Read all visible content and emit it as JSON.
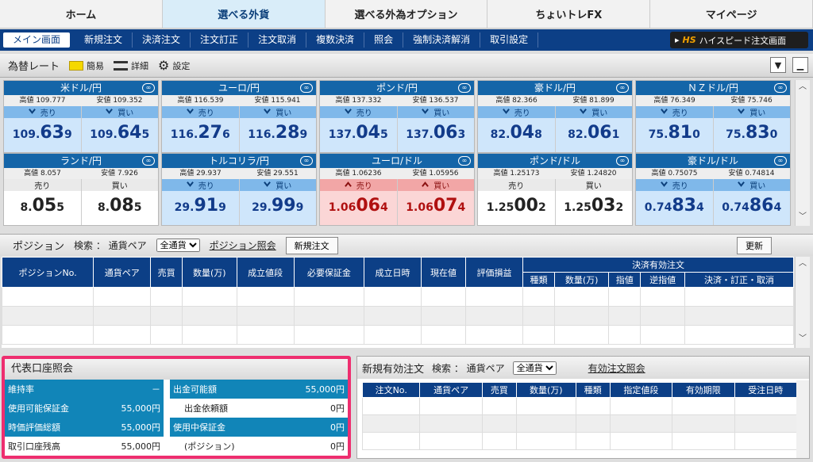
{
  "topnav": [
    "ホーム",
    "選べる外貨",
    "選べる外為オプション",
    "ちょいトレFX",
    "マイページ"
  ],
  "subnav": [
    "メイン画面",
    "新規注文",
    "決済注文",
    "注文訂正",
    "注文取消",
    "複数決済",
    "照会",
    "強制決済解消",
    "取引設定"
  ],
  "highspeed": {
    "hs": "HS",
    "label": "ハイスピード注文画面"
  },
  "ratebar": {
    "title": "為替レート",
    "simple": "簡易",
    "detail": "詳細",
    "settings": "設定"
  },
  "rates": [
    {
      "pair": "米ドル/円",
      "high": "高値 109.777",
      "low": "安値 109.352",
      "sell_label": "売り",
      "buy_label": "買い",
      "sell": [
        "109.",
        "63",
        "9"
      ],
      "buy": [
        "109.",
        "64",
        "5"
      ],
      "style": "blue"
    },
    {
      "pair": "ユーロ/円",
      "high": "高値 116.539",
      "low": "安値 115.941",
      "sell_label": "売り",
      "buy_label": "買い",
      "sell": [
        "116.",
        "27",
        "6"
      ],
      "buy": [
        "116.",
        "28",
        "9"
      ],
      "style": "blue"
    },
    {
      "pair": "ポンド/円",
      "high": "高値 137.332",
      "low": "安値 136.537",
      "sell_label": "売り",
      "buy_label": "買い",
      "sell": [
        "137.",
        "04",
        "5"
      ],
      "buy": [
        "137.",
        "06",
        "3"
      ],
      "style": "blue"
    },
    {
      "pair": "豪ドル/円",
      "high": "高値 82.366",
      "low": "安値 81.899",
      "sell_label": "売り",
      "buy_label": "買い",
      "sell": [
        "82.",
        "04",
        "8"
      ],
      "buy": [
        "82.",
        "06",
        "1"
      ],
      "style": "blue"
    },
    {
      "pair": "ＮＺドル/円",
      "high": "高値 76.349",
      "low": "安値 75.746",
      "sell_label": "売り",
      "buy_label": "買い",
      "sell": [
        "75.",
        "81",
        "0"
      ],
      "buy": [
        "75.",
        "83",
        "0"
      ],
      "style": "blue"
    },
    {
      "pair": "ランド/円",
      "high": "高値 8.057",
      "low": "安値 7.926",
      "sell_label": "売り",
      "buy_label": "買い",
      "sell": [
        "8.",
        "05",
        "5"
      ],
      "buy": [
        "8.",
        "08",
        "5"
      ],
      "style": "grey"
    },
    {
      "pair": "トルコリラ/円",
      "high": "高値 29.937",
      "low": "安値 29.551",
      "sell_label": "売り",
      "buy_label": "買い",
      "sell": [
        "29.",
        "91",
        "9"
      ],
      "buy": [
        "29.",
        "99",
        "9"
      ],
      "style": "blue"
    },
    {
      "pair": "ユーロ/ドル",
      "high": "高値 1.06236",
      "low": "安値 1.05956",
      "sell_label": "売り",
      "buy_label": "買い",
      "sell": [
        "1.06",
        "06",
        "4"
      ],
      "buy": [
        "1.06",
        "07",
        "4"
      ],
      "style": "red"
    },
    {
      "pair": "ポンド/ドル",
      "high": "高値 1.25173",
      "low": "安値 1.24820",
      "sell_label": "売り",
      "buy_label": "買い",
      "sell": [
        "1.25",
        "00",
        "2"
      ],
      "buy": [
        "1.25",
        "03",
        "2"
      ],
      "style": "grey"
    },
    {
      "pair": "豪ドル/ドル",
      "high": "高値 0.75075",
      "low": "安値 0.74814",
      "sell_label": "売り",
      "buy_label": "買い",
      "sell": [
        "0.74",
        "83",
        "4"
      ],
      "buy": [
        "0.74",
        "86",
        "4"
      ],
      "style": "blue"
    }
  ],
  "position": {
    "title": "ポジション",
    "search": "検索 ： 通貨ペア",
    "select": "全通貨",
    "link": "ポジション照会",
    "new_order": "新規注文",
    "refresh": "更新",
    "headers": [
      "ポジションNo.",
      "通貨ペア",
      "売買",
      "数量(万)",
      "成立値段",
      "必要保証金",
      "成立日時",
      "現在値",
      "評価損益"
    ],
    "group": "決済有効注文",
    "subheaders": [
      "種類",
      "数量(万)",
      "指値",
      "逆指値",
      "決済・訂正・取消"
    ]
  },
  "account": {
    "title": "代表口座照会",
    "rows": [
      {
        "l": "維持率",
        "lv": "－",
        "r": "出金可能額",
        "rv": "55,000円"
      },
      {
        "l": "使用可能保証金",
        "lv": "55,000円",
        "r": "出金依頼額",
        "rv": "0円"
      },
      {
        "l": "時価評価総額",
        "lv": "55,000円",
        "r": "使用中保証金",
        "rv": "0円"
      },
      {
        "l": "取引口座残高",
        "lv": "55,000円",
        "r": "(ポジション)",
        "rv": "0円"
      }
    ]
  },
  "orders": {
    "title": "新規有効注文",
    "search": "検索 ： 通貨ペア",
    "select": "全通貨",
    "link": "有効注文照会",
    "headers": [
      "注文No.",
      "通貨ペア",
      "売買",
      "数量(万)",
      "種類",
      "指定値段",
      "有効期限",
      "受注日時"
    ]
  }
}
